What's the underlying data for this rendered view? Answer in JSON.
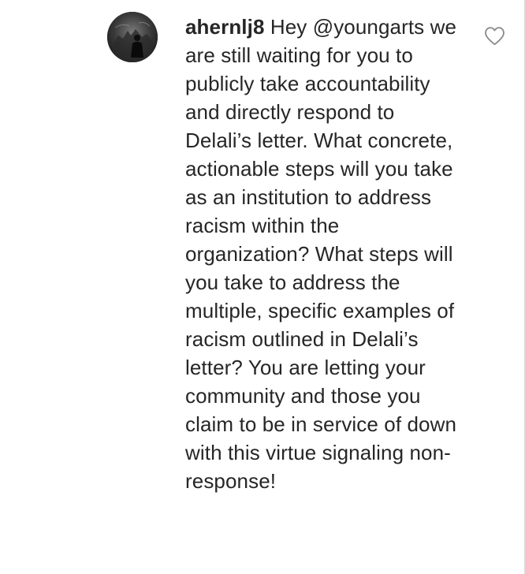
{
  "comment": {
    "username": "ahernlj8",
    "text": "Hey @youngarts we are still waiting for you to publicly take accountability and directly respond to Delali’s letter. What concrete, actionable steps will you take as an institution to address racism within the organization? What steps will you take to address the multiple, specific examples of racism outlined in Delali’s letter? You are letting your community and those you claim to be in service of down with this virtue signaling non-response!",
    "avatar_icon": "user-avatar",
    "like_icon": "heart-outline-icon"
  },
  "colors": {
    "text": "#262626",
    "icon_stroke": "#8e8e8e",
    "divider": "#dbdbdb"
  }
}
